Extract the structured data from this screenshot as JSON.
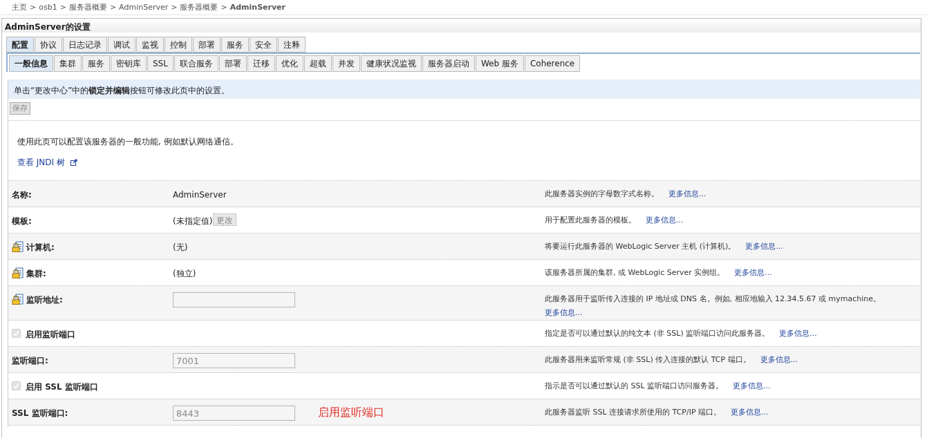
{
  "breadcrumb": [
    {
      "label": "主页",
      "current": false
    },
    {
      "label": "osb1",
      "current": false
    },
    {
      "label": "服务器概要",
      "current": false
    },
    {
      "label": "AdminServer",
      "current": false
    },
    {
      "label": "服务器概要",
      "current": false
    },
    {
      "label": "AdminServer",
      "current": true
    }
  ],
  "breadcrumb_separator": ">",
  "panel": {
    "title": "AdminServer的设置"
  },
  "tabs": [
    {
      "label": "配置",
      "selected": true
    },
    {
      "label": "协议",
      "selected": false
    },
    {
      "label": "日志记录",
      "selected": false
    },
    {
      "label": "调试",
      "selected": false
    },
    {
      "label": "监视",
      "selected": false
    },
    {
      "label": "控制",
      "selected": false
    },
    {
      "label": "部署",
      "selected": false
    },
    {
      "label": "服务",
      "selected": false
    },
    {
      "label": "安全",
      "selected": false
    },
    {
      "label": "注释",
      "selected": false
    }
  ],
  "subtabs": [
    {
      "label": "一般信息",
      "selected": true
    },
    {
      "label": "集群",
      "selected": false
    },
    {
      "label": "服务",
      "selected": false
    },
    {
      "label": "密钥库",
      "selected": false
    },
    {
      "label": "SSL",
      "selected": false
    },
    {
      "label": "联合服务",
      "selected": false
    },
    {
      "label": "部署",
      "selected": false
    },
    {
      "label": "迁移",
      "selected": false
    },
    {
      "label": "优化",
      "selected": false
    },
    {
      "label": "超载",
      "selected": false
    },
    {
      "label": "并发",
      "selected": false
    },
    {
      "label": "健康状况监视",
      "selected": false
    },
    {
      "label": "服务器启动",
      "selected": false
    },
    {
      "label": "Web 服务",
      "selected": false
    },
    {
      "label": "Coherence",
      "selected": false
    }
  ],
  "notice": "单击“更改中心”中的**锁定并编辑**按钮可修改此页中的设置。",
  "save_button": {
    "label": "保存",
    "disabled": true
  },
  "description": "使用此页可以配置该服务器的一般功能, 例如默认网络通信。",
  "jndi_link": "查看 JNDI 树",
  "rows": [
    {
      "kind": "text",
      "label": "名称:",
      "locked": false,
      "value": "AdminServer",
      "help": "此服务器实例的字母数字式名称。",
      "more": "更多信息..."
    },
    {
      "kind": "text_button",
      "label": "模板:",
      "locked": false,
      "value": "(未指定值)",
      "button": "更改",
      "help": "用于配置此服务器的模板。",
      "more": "更多信息..."
    },
    {
      "kind": "text",
      "label": "计算机:",
      "locked": true,
      "value": "(无)",
      "help": "将要运行此服务器的 WebLogic Server 主机 (计算机)。",
      "more": "更多信息..."
    },
    {
      "kind": "text",
      "label": "集群:",
      "locked": true,
      "value": "(独立)",
      "help": "该服务器所属的集群, 或 WebLogic Server 实例组。",
      "more": "更多信息..."
    },
    {
      "kind": "field",
      "label": "监听地址:",
      "locked": true,
      "value": "",
      "help": "此服务器用于监听传入连接的 IP 地址或 DNS 名。例如, 相应地输入 12.34.5.67 或 mymachine。",
      "more": "更多信息..."
    },
    {
      "kind": "checkbox",
      "label": "启用监听端口",
      "locked": false,
      "checked": true,
      "help": "指定是否可以通过默认的纯文本 (非 SSL) 监听端口访问此服务器。",
      "more": "更多信息..."
    },
    {
      "kind": "field",
      "label": "监听端口:",
      "locked": false,
      "value": "7001",
      "help": "此服务器用来监听常规 (非 SSL) 传入连接的默认 TCP 端口。",
      "more": "更多信息..."
    },
    {
      "kind": "checkbox",
      "label": "启用 SSL 监听端口",
      "locked": false,
      "checked": true,
      "help": "指示是否可以通过默认的 SSL 监听端口访问服务器。",
      "more": "更多信息..."
    },
    {
      "kind": "field",
      "label": "SSL 监听端口:",
      "locked": false,
      "value": "8443",
      "annotation": "启用监听端口",
      "help": "此服务器监听 SSL 连接请求所使用的 TCP/IP 端口。",
      "more": "更多信息..."
    }
  ]
}
